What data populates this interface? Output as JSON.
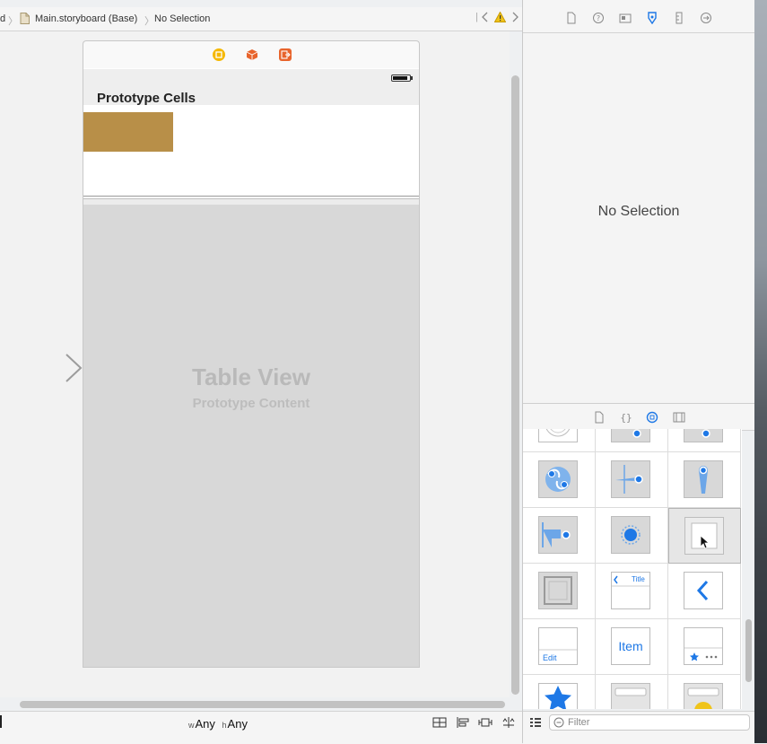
{
  "jump_bar": {
    "crumb_prefix": "d",
    "file": "Main.storyboard (Base)",
    "selection": "No Selection"
  },
  "scene": {
    "header_title": "Prototype Cells",
    "table_view_label": "Table View",
    "table_view_sublabel": "Prototype Content"
  },
  "bottom_bar": {
    "left_glyph": "",
    "width_prefix": "w",
    "width_value": "Any",
    "height_prefix": "h",
    "height_value": "Any"
  },
  "inspector": {
    "empty_message": "No Selection"
  },
  "library": {
    "item_label": "Item",
    "title_label": "Title",
    "edit_label": "Edit",
    "filter_placeholder": "Filter"
  },
  "colors": {
    "accent_blue": "#1e78e6",
    "cell_thumbnail": "#b88f48",
    "warning_yellow": "#f0c419",
    "dock_yellow": "#f5b800",
    "dock_orange": "#e8642c"
  }
}
